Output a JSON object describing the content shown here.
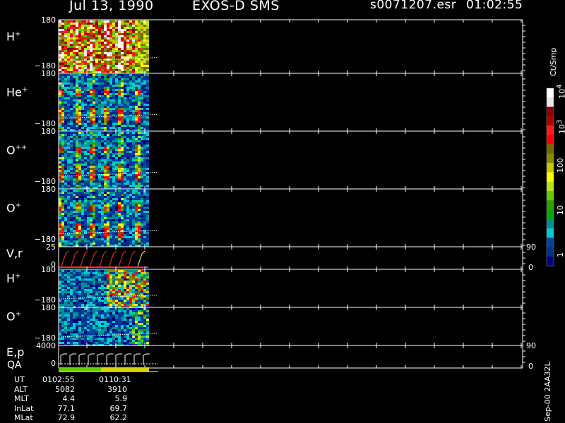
{
  "header": {
    "date": "Jul 13, 1990",
    "instrument": "EXOS-D SMS",
    "file": "s0071207.esr",
    "time": "01:02:55"
  },
  "colorbar": {
    "unit": "Ct/Smp",
    "tick_labels": [
      "10",
      "10",
      "100",
      "1",
      "10",
      "10"
    ],
    "tick_exps": [
      "4",
      "3",
      "",
      "",
      "",
      ""
    ],
    "colors": [
      "#ffffff",
      "#e8e8e8",
      "#8b0000",
      "#b00000",
      "#ff1a1a",
      "#ff0000",
      "#6b6b00",
      "#8a8a00",
      "#c8c800",
      "#ffff00",
      "#b5e61d",
      "#66cc00",
      "#2ea000",
      "#00aa00",
      "#009090",
      "#00cccc",
      "#0040a0",
      "#00308a",
      "#000080"
    ]
  },
  "panels": [
    {
      "label_main": "H",
      "label_sup": "+",
      "ymax": "180",
      "ymin": "−180",
      "kind": "H1"
    },
    {
      "label_main": "He",
      "label_sup": "+",
      "ymax": "180",
      "ymin": "−180",
      "kind": "He"
    },
    {
      "label_main": "O",
      "label_sup": "++",
      "ymax": "180",
      "ymin": "−180",
      "kind": "O2"
    },
    {
      "label_main": "O",
      "label_sup": "+",
      "ymax": "180",
      "ymin": "−180",
      "kind": "O1"
    },
    {
      "label_main": "V,r",
      "label_sup": "",
      "ymax": "25",
      "ymin": "0",
      "right_top": "90",
      "right_bottom": "0",
      "kind": "Vr"
    },
    {
      "label_main": "H",
      "label_sup": "+",
      "ymax": "180",
      "ymin": "−180",
      "kind": "H2"
    },
    {
      "label_main": "O",
      "label_sup": "+",
      "ymax": "180",
      "ymin": "−180",
      "kind": "O3"
    },
    {
      "label_main": "E,p",
      "label_sup": "",
      "ymax": "4000",
      "ymin": "0",
      "right_top": "90",
      "right_bottom": "0",
      "kind": "Ep"
    }
  ],
  "qa_label": "QA",
  "info_table": {
    "rows": [
      {
        "label": "UT",
        "v1": "0102:55",
        "v2": "0110:31"
      },
      {
        "label": "ALT",
        "v1": "5082",
        "v2": "3910"
      },
      {
        "label": "MLT",
        "v1": "4.4",
        "v2": "5.9"
      },
      {
        "label": "InLat",
        "v1": "77.1",
        "v2": "69.7"
      },
      {
        "label": "MLat",
        "v1": "72.9",
        "v2": "62.2"
      }
    ]
  },
  "footer_vertical": "Sep-00 2AA32L",
  "chart_data": {
    "type": "heatmap",
    "title": "Jul 13, 1990   EXOS-D SMS",
    "ylabel_panels": [
      "H+",
      "He+",
      "O++",
      "O+",
      "V,r",
      "H+",
      "O+",
      "E,p"
    ],
    "y_ranges": [
      [
        -180,
        180
      ],
      [
        -180,
        180
      ],
      [
        -180,
        180
      ],
      [
        -180,
        180
      ],
      [
        0,
        25
      ],
      [
        -180,
        180
      ],
      [
        -180,
        180
      ],
      [
        0,
        4000
      ]
    ],
    "x_range_ut": [
      "0102:55",
      "0110:31"
    ],
    "colorscale_ct_per_smp": [
      1,
      10,
      100,
      1000,
      10000
    ]
  }
}
